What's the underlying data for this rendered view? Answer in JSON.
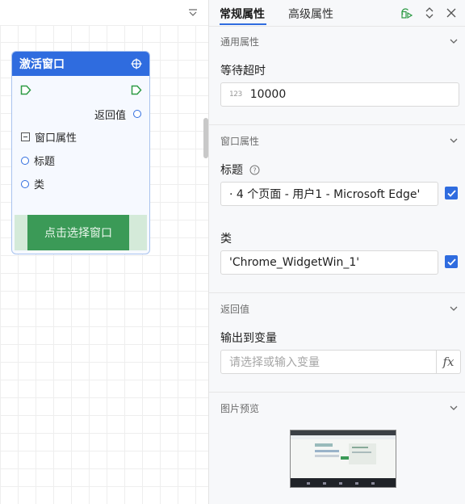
{
  "canvas": {
    "node": {
      "title": "激活窗口",
      "return_label": "返回值",
      "group_label": "窗口属性",
      "param_title": "标题",
      "param_class": "类",
      "select_button": "点击选择窗口"
    }
  },
  "tabs": {
    "general": "常规属性",
    "advanced": "高级属性"
  },
  "sections": {
    "general": {
      "header": "通用属性",
      "timeout_label": "等待超时",
      "timeout_value": "10000"
    },
    "window": {
      "header": "窗口属性",
      "title_label": "标题",
      "title_value": "· 4 个页面 - 用户1 - Microsoft Edge'",
      "class_label": "类",
      "class_value": "'Chrome_WidgetWin_1'"
    },
    "return": {
      "header": "返回值",
      "output_label": "输出到变量",
      "output_placeholder": "请选择或输入变量",
      "fx_label": "fx"
    },
    "preview": {
      "header": "图片预览"
    }
  },
  "colors": {
    "accent": "#2f6cdf",
    "button_green": "#3b9a57",
    "panel_bg": "#f7f8fa"
  }
}
